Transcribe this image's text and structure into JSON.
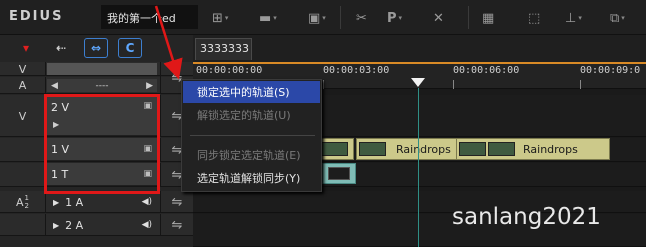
{
  "app": {
    "logo": "EDIUS",
    "project_title": "我的第一个ed"
  },
  "toolbar": {
    "buttons": [
      {
        "icon": "sequence-icon",
        "glyph": "⊞"
      },
      {
        "icon": "folder-icon",
        "glyph": "▬"
      },
      {
        "icon": "save-icon",
        "glyph": "▣"
      },
      {
        "icon": "cut-icon",
        "glyph": "✂"
      },
      {
        "icon": "p-icon",
        "glyph": "P"
      },
      {
        "icon": "delete-icon",
        "glyph": "✕"
      },
      {
        "icon": "grid-icon",
        "glyph": "▦"
      },
      {
        "icon": "ripple-delete-icon",
        "glyph": "⬚"
      },
      {
        "icon": "marker-icon",
        "glyph": "⊥"
      },
      {
        "icon": "snapshot-icon",
        "glyph": "⧉"
      }
    ]
  },
  "left_panel": {
    "header_icons": [
      "▾",
      "⇠",
      "⇔",
      "C"
    ],
    "rows": {
      "v_label": "V",
      "a_label": "A",
      "a_dropdown": "----",
      "v2_label": "V",
      "v2_track": "2 V",
      "v1_track": "1 V",
      "t1_track": "1 T",
      "a12_label": "A",
      "a12_sub_top": "1",
      "a12_sub_bottom": "2",
      "a1_track": "1 A",
      "a2_track": "2 A"
    }
  },
  "timeline": {
    "tab": "3333333",
    "timecodes": [
      "00:00:00:00",
      "00:00:03:00",
      "00:00:06:00",
      "00:00:09:0"
    ],
    "clips": [
      "Raindrops",
      "Raindrops"
    ]
  },
  "context_menu": {
    "items": [
      {
        "label": "锁定选中的轨道(S)",
        "state": "active"
      },
      {
        "label": "解锁选定的轨道(U)",
        "state": "disabled"
      },
      {
        "label": "同步锁定选定轨道(E)",
        "state": "disabled"
      },
      {
        "label": "选定轨道解锁同步(Y)",
        "state": "enabled"
      }
    ]
  },
  "watermark": "sanlang2021",
  "colors": {
    "accent": "#2b48a8",
    "highlight": "#e01818",
    "clip": "#ccc98a",
    "cursor": "#2f8f86"
  }
}
